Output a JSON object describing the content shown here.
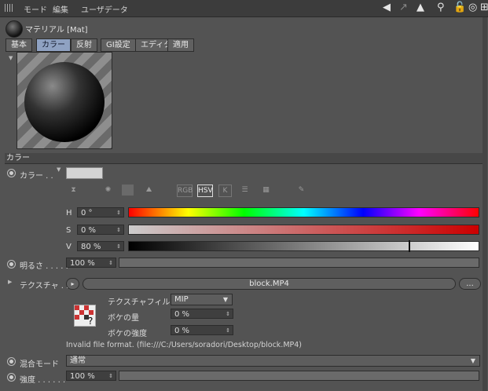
{
  "menu": {
    "mode": "モード",
    "edit": "編集",
    "userdata": "ユーザデータ"
  },
  "material": {
    "title": "マテリアル [Mat]"
  },
  "tabs": [
    {
      "label": "基本"
    },
    {
      "label": "カラー"
    },
    {
      "label": "反射"
    },
    {
      "label": "GI設定"
    },
    {
      "label": "エディタ"
    },
    {
      "label": "適用"
    }
  ],
  "section": {
    "title": "カラー"
  },
  "color": {
    "label": "カラー . .",
    "swatch_color": "#d4d4d4",
    "tools": [
      "RGB",
      "HSV",
      "K"
    ],
    "h_label": "H",
    "h_value": "0 °",
    "s_label": "S",
    "s_value": "0 %",
    "v_label": "V",
    "v_value": "80 %"
  },
  "brightness": {
    "label": "明るさ . . . . .",
    "value": "100 %"
  },
  "texture": {
    "label": "テクスチャ . .",
    "file": "block.MP4",
    "more": "...",
    "filter_label": "テクスチャフィルタ",
    "filter_value": "MIP",
    "blur_offset_label": "ボケの量",
    "blur_offset_value": "0 %",
    "blur_scale_label": "ボケの強度",
    "blur_scale_value": "0 %",
    "error": "Invalid file format. (file:///C:/Users/soradori/Desktop/block.MP4)"
  },
  "mix": {
    "label": "混合モード",
    "value": "通常"
  },
  "strength": {
    "label": "強度 . . . . . .",
    "value": "100 %"
  },
  "colors": {
    "accent": "#8fa2c2",
    "background": "#535353"
  }
}
